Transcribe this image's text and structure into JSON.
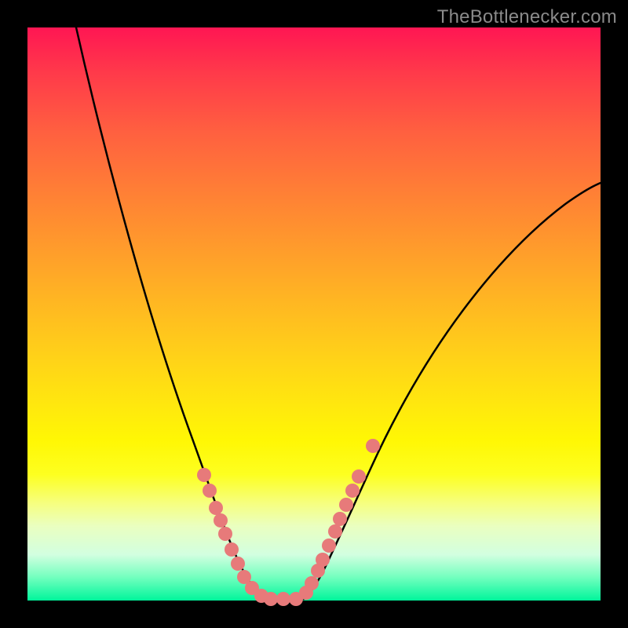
{
  "watermark": "TheBottlenecker.com",
  "colors": {
    "page_bg": "#000000",
    "gradient_top": "#ff1653",
    "gradient_bottom": "#00f59b",
    "curve": "#000000",
    "data_point": "#e77a7a",
    "watermark_text": "#8a8a8a"
  },
  "chart_data": {
    "type": "line",
    "title": "",
    "xlabel": "",
    "ylabel": "",
    "xlim": [
      0,
      100
    ],
    "ylim": [
      0,
      100
    ],
    "grid": false,
    "legend": false,
    "background": "heatmap-gradient-vertical",
    "series": [
      {
        "name": "bottleneck-curve",
        "description": "V-shaped bottleneck curve with a flat minimum; left branch starts at top-left, right branch rises toward upper-right.",
        "x": [
          0,
          4,
          8,
          12,
          16,
          20,
          24,
          28,
          32,
          36,
          40,
          42,
          44,
          46,
          48,
          50,
          54,
          58,
          62,
          68,
          74,
          80,
          88,
          96,
          100
        ],
        "y": [
          100,
          92,
          83,
          74,
          64,
          54,
          44,
          34,
          24,
          15,
          7,
          3,
          0,
          0,
          0,
          3,
          9,
          16,
          24,
          34,
          44,
          54,
          64,
          70,
          73
        ]
      }
    ],
    "scatter": {
      "name": "sample-points",
      "color": "#e77a7a",
      "x": [
        26,
        27,
        28,
        29,
        30,
        31,
        32,
        33,
        35,
        37,
        39,
        41,
        43,
        45,
        46,
        47,
        48,
        49,
        50,
        51,
        52,
        53,
        54,
        56
      ],
      "y": [
        22,
        19,
        16,
        14,
        11,
        8,
        6,
        4,
        2,
        1,
        0,
        0,
        0,
        1,
        3,
        5,
        7,
        9,
        12,
        14,
        17,
        19,
        21,
        27
      ]
    },
    "annotations": [
      {
        "text": "TheBottlenecker.com",
        "position": "top-right"
      }
    ]
  }
}
